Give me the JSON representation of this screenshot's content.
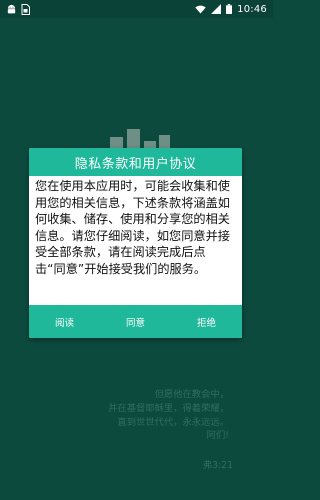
{
  "status_bar": {
    "time": "10:46"
  },
  "icons": {
    "status_left": [
      "android-icon",
      "sim-card-icon"
    ],
    "status_right": [
      "wifi-icon",
      "signal-icon",
      "battery-icon"
    ],
    "hero": "books-icon"
  },
  "dialog": {
    "title": "隐私条款和用户协议",
    "body": "您在使用本应用时，可能会收集和使用您的相关信息，下述条款将涵盖如何收集、储存、使用和分享您的相关信息。请您仔细阅读，如您同意并接受全部条款，请在阅读完成后点击“同意”开始接受我们的服务。",
    "buttons": {
      "read": "阅读",
      "agree": "同意",
      "reject": "拒绝"
    }
  },
  "verse": {
    "lines": [
      "但愿他在教会中，",
      "并在基督耶稣里，得着荣耀，",
      "直到世世代代，永永远远。",
      "阿们!"
    ],
    "reference": "弗3:21"
  },
  "colors": {
    "background": "#0d4a3e",
    "accent": "#1fb89a",
    "verse_text": "#2f6e60"
  }
}
